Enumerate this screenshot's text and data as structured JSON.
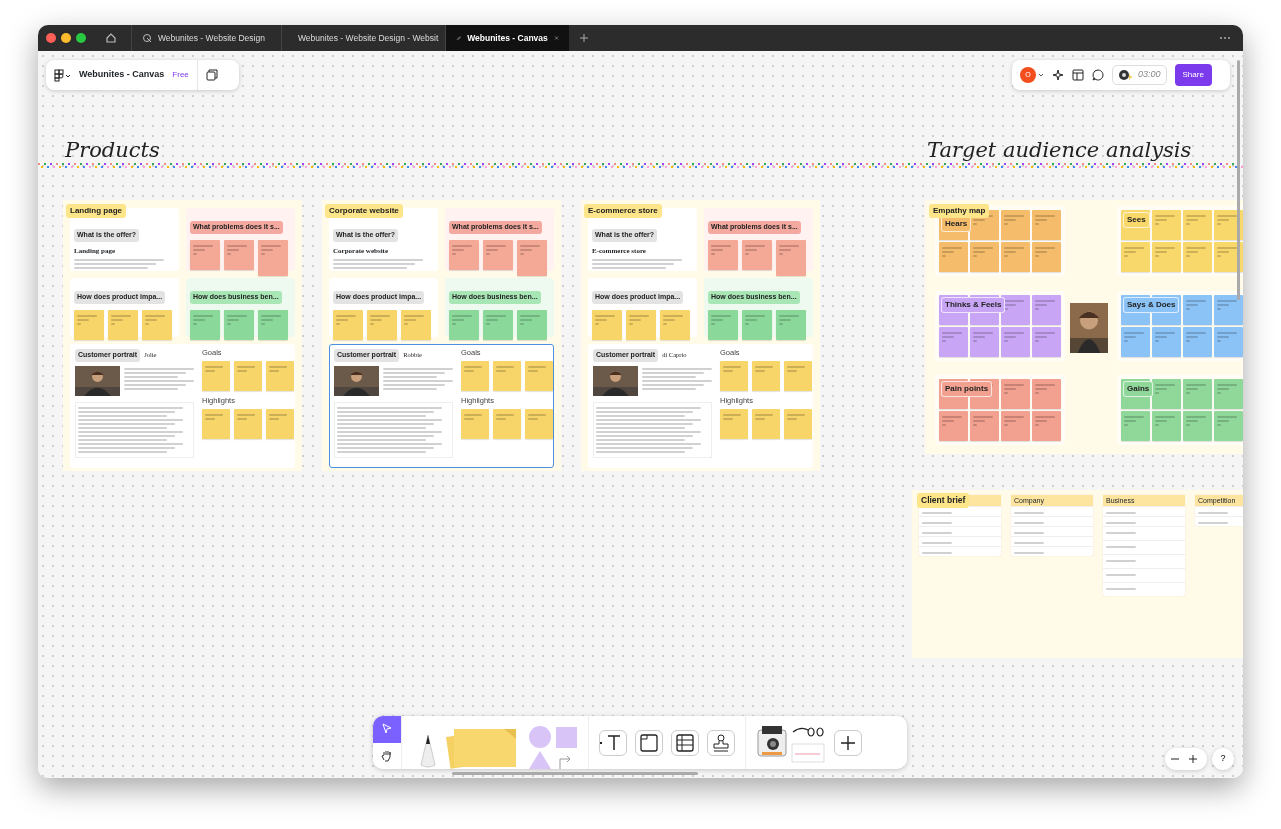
{
  "tabs": [
    {
      "label": "Webunites - Website Design",
      "kind": "design",
      "selected": false
    },
    {
      "label": "Webunites - Website Design - Websit",
      "kind": "prototype",
      "selected": false
    },
    {
      "label": "Webunites - Canvas",
      "kind": "canvas",
      "selected": true
    }
  ],
  "file": {
    "name": "Webunites - Canvas",
    "plan": "Free"
  },
  "header": {
    "user_initial": "O",
    "timer": "03:00",
    "share": "Share"
  },
  "sections": [
    {
      "title": "Products"
    },
    {
      "title": "Target audience analysis"
    }
  ],
  "products": [
    {
      "label": "Landing page",
      "offer_heading": "What is the offer?",
      "offer_title": "Landing page",
      "problems_heading": "What problems does it s...",
      "impact_heading": "How does product impa...",
      "benefit_heading": "How does business ben...",
      "portrait_heading": "Customer portrait",
      "person_name": "Jolie",
      "goals": "Goals",
      "highlights": "Highlights",
      "selected": false
    },
    {
      "label": "Corporate website",
      "offer_heading": "What is the offer?",
      "offer_title": "Corporate website",
      "problems_heading": "What problems does it s...",
      "impact_heading": "How does product impa...",
      "benefit_heading": "How does business ben...",
      "portrait_heading": "Customer portrait",
      "person_name": "Robbie",
      "goals": "Goals",
      "highlights": "Highlights",
      "selected": true
    },
    {
      "label": "E-commerce store",
      "offer_heading": "What is the offer?",
      "offer_title": "E-commerce store",
      "problems_heading": "What problems does it s...",
      "impact_heading": "How does product impa...",
      "benefit_heading": "How does business ben...",
      "portrait_heading": "Customer portrait",
      "person_name": "di Caprio",
      "goals": "Goals",
      "highlights": "Highlights",
      "selected": false
    }
  ],
  "empathy_map": {
    "label": "Empathy map",
    "quadrants": [
      {
        "title": "Hears",
        "color": "#f5bd6b"
      },
      {
        "title": "Sees",
        "color": "#f9d86b"
      },
      {
        "title": "Thinks & Feels",
        "color": "#c9a6f5"
      },
      {
        "title": "Says & Does",
        "color": "#8cc3f7"
      },
      {
        "title": "Pain points",
        "color": "#f2a08f"
      },
      {
        "title": "Gains",
        "color": "#8fd89a"
      }
    ]
  },
  "client_brief": {
    "label": "Client brief",
    "tables": [
      {
        "heading": "Company"
      },
      {
        "heading": "Business"
      },
      {
        "heading": "Competition"
      }
    ]
  },
  "toolbar": {
    "tools": [
      {
        "kind": "select",
        "selected": true
      },
      {
        "kind": "hand",
        "selected": false
      }
    ]
  },
  "zoom": {
    "help": "?"
  }
}
